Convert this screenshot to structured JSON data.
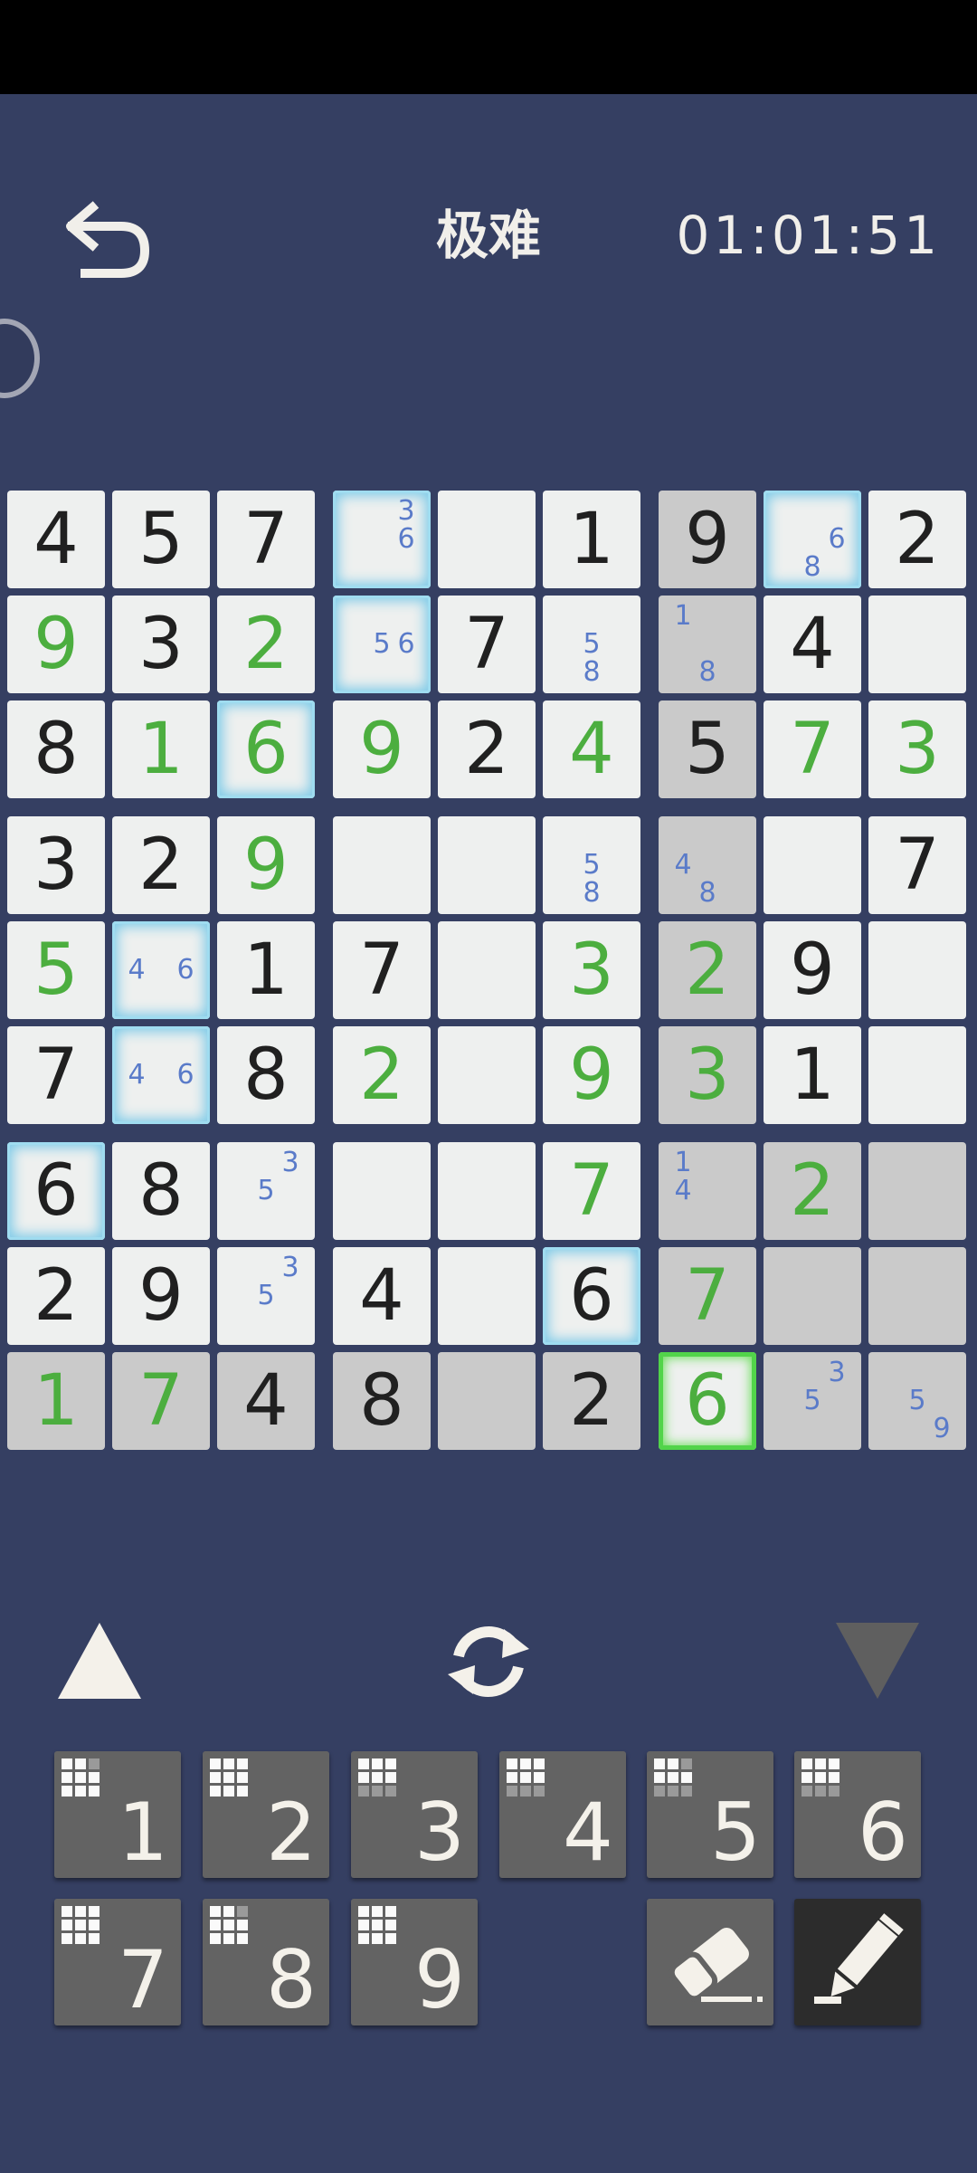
{
  "header": {
    "title": "极难",
    "timer": "01:01:51"
  },
  "icons": {
    "back": "back-arrow-icon",
    "side_handle": "side-handle-icon",
    "prev": "triangle-up-icon",
    "next": "triangle-down-icon",
    "redo": "refresh-icon",
    "eraser": "eraser-icon",
    "pencil": "pencil-icon"
  },
  "colors": {
    "background": "#353f62",
    "cell": "#eef0ef",
    "cell_highlight_gray": "#cacaca",
    "given_digit": "#202020",
    "entered_digit": "#4cae3f",
    "note_digit": "#5a7bc9",
    "highlight_glow": "#7fcbe8",
    "selected_glow": "#52d44a",
    "keypad": "#636363",
    "keypad_active": "#2c2c2c"
  },
  "grid": [
    [
      {
        "v": "4",
        "t": "g"
      },
      {
        "v": "5",
        "t": "g"
      },
      {
        "v": "7",
        "t": "g"
      },
      {
        "n": [
          "3",
          "6"
        ],
        "hl": 1
      },
      {},
      {
        "v": "1",
        "t": "g"
      },
      {
        "v": "9",
        "t": "g",
        "gray": 1
      },
      {
        "n": [
          "6",
          "8"
        ],
        "hl": 1
      },
      {
        "v": "2",
        "t": "g"
      }
    ],
    [
      {
        "v": "9",
        "t": "u"
      },
      {
        "v": "3",
        "t": "g"
      },
      {
        "v": "2",
        "t": "u"
      },
      {
        "n": [
          "5",
          "6"
        ],
        "hl": 1
      },
      {
        "v": "7",
        "t": "g"
      },
      {
        "n": [
          "5",
          "8"
        ]
      },
      {
        "n": [
          "1",
          "8"
        ],
        "gray": 1
      },
      {
        "v": "4",
        "t": "g"
      },
      {}
    ],
    [
      {
        "v": "8",
        "t": "g"
      },
      {
        "v": "1",
        "t": "u"
      },
      {
        "v": "6",
        "t": "u",
        "hl": 1
      },
      {
        "v": "9",
        "t": "u"
      },
      {
        "v": "2",
        "t": "g"
      },
      {
        "v": "4",
        "t": "u"
      },
      {
        "v": "5",
        "t": "g",
        "gray": 1
      },
      {
        "v": "7",
        "t": "u"
      },
      {
        "v": "3",
        "t": "u"
      }
    ],
    [
      {
        "v": "3",
        "t": "g"
      },
      {
        "v": "2",
        "t": "g"
      },
      {
        "v": "9",
        "t": "u"
      },
      {},
      {},
      {
        "n": [
          "5",
          "8"
        ]
      },
      {
        "n": [
          "4",
          "8"
        ],
        "gray": 1
      },
      {},
      {
        "v": "7",
        "t": "g"
      }
    ],
    [
      {
        "v": "5",
        "t": "u"
      },
      {
        "n": [
          "4",
          "6"
        ],
        "hl": 1
      },
      {
        "v": "1",
        "t": "g"
      },
      {
        "v": "7",
        "t": "g"
      },
      {},
      {
        "v": "3",
        "t": "u"
      },
      {
        "v": "2",
        "t": "u",
        "gray": 1
      },
      {
        "v": "9",
        "t": "g"
      },
      {}
    ],
    [
      {
        "v": "7",
        "t": "g"
      },
      {
        "n": [
          "4",
          "6"
        ],
        "hl": 1
      },
      {
        "v": "8",
        "t": "g"
      },
      {
        "v": "2",
        "t": "u"
      },
      {},
      {
        "v": "9",
        "t": "u"
      },
      {
        "v": "3",
        "t": "u",
        "gray": 1
      },
      {
        "v": "1",
        "t": "g"
      },
      {}
    ],
    [
      {
        "v": "6",
        "t": "g",
        "hl": 1
      },
      {
        "v": "8",
        "t": "g"
      },
      {
        "n": [
          "3",
          "5"
        ]
      },
      {},
      {},
      {
        "v": "7",
        "t": "u"
      },
      {
        "n": [
          "1",
          "4"
        ],
        "gray": 1
      },
      {
        "v": "2",
        "t": "u",
        "gray": 1
      },
      {
        "gray": 1
      }
    ],
    [
      {
        "v": "2",
        "t": "g"
      },
      {
        "v": "9",
        "t": "g"
      },
      {
        "n": [
          "3",
          "5"
        ]
      },
      {
        "v": "4",
        "t": "g"
      },
      {},
      {
        "v": "6",
        "t": "g",
        "hl": 1
      },
      {
        "v": "7",
        "t": "u",
        "gray": 1
      },
      {
        "gray": 1
      },
      {
        "gray": 1
      }
    ],
    [
      {
        "v": "1",
        "t": "u",
        "gray": 1
      },
      {
        "v": "7",
        "t": "u",
        "gray": 1
      },
      {
        "v": "4",
        "t": "g",
        "gray": 1
      },
      {
        "v": "8",
        "t": "g",
        "gray": 1
      },
      {
        "gray": 1
      },
      {
        "v": "2",
        "t": "g",
        "gray": 1
      },
      {
        "v": "6",
        "t": "u",
        "sel": 1
      },
      {
        "n": [
          "3",
          "5"
        ],
        "gray": 1
      },
      {
        "n": [
          "5",
          "9"
        ],
        "gray": 1
      }
    ]
  ],
  "keypad": [
    {
      "label": "1",
      "done": [
        1,
        1,
        0,
        1,
        1,
        1,
        1,
        1,
        1
      ]
    },
    {
      "label": "2",
      "done": [
        1,
        1,
        1,
        1,
        1,
        1,
        1,
        1,
        1
      ]
    },
    {
      "label": "3",
      "done": [
        1,
        1,
        1,
        1,
        1,
        1,
        0,
        0,
        0
      ]
    },
    {
      "label": "4",
      "done": [
        1,
        1,
        1,
        1,
        1,
        1,
        0,
        0,
        0
      ]
    },
    {
      "label": "5",
      "done": [
        1,
        1,
        0,
        1,
        1,
        1,
        0,
        0,
        0
      ]
    },
    {
      "label": "6",
      "done": [
        1,
        1,
        1,
        1,
        1,
        1,
        0,
        0,
        0
      ]
    },
    {
      "label": "7",
      "done": [
        1,
        1,
        1,
        1,
        1,
        1,
        1,
        1,
        1
      ]
    },
    {
      "label": "8",
      "done": [
        1,
        1,
        0,
        1,
        1,
        1,
        1,
        1,
        1
      ]
    },
    {
      "label": "9",
      "done": [
        1,
        1,
        1,
        1,
        1,
        1,
        1,
        1,
        1
      ]
    }
  ]
}
